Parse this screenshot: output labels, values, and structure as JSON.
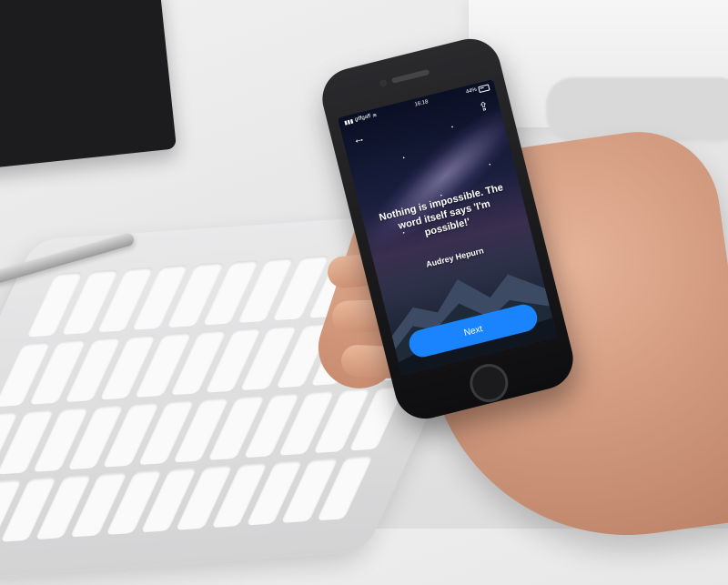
{
  "status_bar": {
    "carrier": "giffgaff",
    "time": "16:18",
    "battery": "44%"
  },
  "nav": {
    "back_icon": "back-arrow-icon",
    "share_icon": "share-icon"
  },
  "content": {
    "quote": "Nothing is impossible. The word itself says 'I'm possible!'",
    "author": "Audrey Hepurn"
  },
  "actions": {
    "next_label": "Next"
  },
  "colors": {
    "button": "#1a84ff",
    "text": "#ffffff"
  }
}
